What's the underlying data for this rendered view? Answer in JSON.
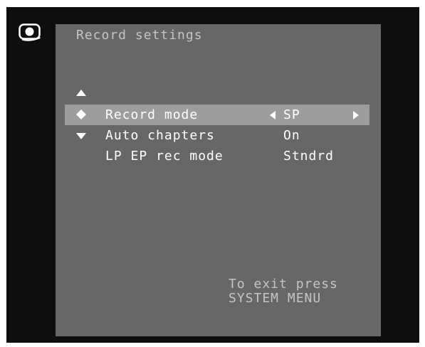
{
  "screen": {
    "title": "Record settings",
    "rows": [
      {
        "label": "Record mode",
        "value": "SP",
        "selected": true
      },
      {
        "label": "Auto chapters",
        "value": "On",
        "selected": false
      },
      {
        "label": "LP EP rec mode",
        "value": "Stndrd",
        "selected": false
      }
    ],
    "exit_hint": {
      "line1": "To exit press",
      "line2": "SYSTEM MENU"
    }
  },
  "icons": {
    "source": "camera-lens-icon",
    "scroll_up": "triangle-up-icon",
    "scroll_down": "triangle-down-icon",
    "cursor": "diamond-cursor-icon",
    "value_prev": "triangle-left-icon",
    "value_next": "triangle-right-icon"
  },
  "colors": {
    "screen_background": "#0e0e0e",
    "panel_background": "#676767",
    "highlight": "#9d9d9d",
    "text": "#ffffff",
    "dim_text": "#c4c4c4"
  }
}
